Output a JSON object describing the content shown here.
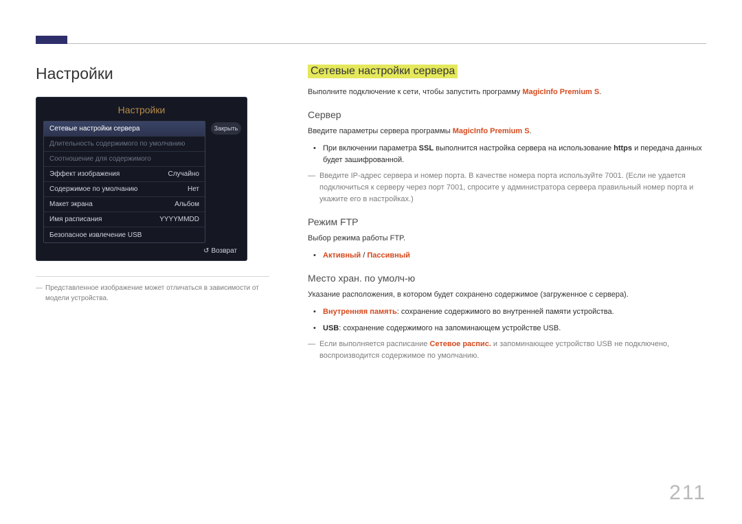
{
  "left": {
    "heading": "Настройки",
    "osd": {
      "title": "Настройки",
      "close": "Закрыть",
      "items": [
        {
          "label": "Сетевые настройки сервера",
          "value": ""
        },
        {
          "label": "Длительность содержимого по умолчанию",
          "value": ""
        },
        {
          "label": "Соотношение для содержимого",
          "value": ""
        },
        {
          "label": "Эффект изображения",
          "value": "Случайно"
        },
        {
          "label": "Содержимое по умолчанию",
          "value": "Нет"
        },
        {
          "label": "Макет экрана",
          "value": "Альбом"
        },
        {
          "label": "Имя расписания",
          "value": "YYYYMMDD"
        },
        {
          "label": "Безопасное извлечение USB",
          "value": ""
        }
      ],
      "return": "Возврат"
    },
    "note": "Представленное изображение может отличаться в зависимости от модели устройства."
  },
  "right": {
    "h2": "Сетевые настройки сервера",
    "intro_a": "Выполните подключение к сети, чтобы запустить программу ",
    "intro_product": "MagicInfo Premium S",
    "intro_b": ".",
    "server_h": "Сервер",
    "server_p1_a": "Введите параметры сервера программы ",
    "server_p1_prod": "MagicInfo Premium S",
    "server_p1_b": ".",
    "server_li_a": "При включении параметра ",
    "server_li_ssl": "SSL",
    "server_li_b": " выполнится настройка сервера на использование ",
    "server_li_https": "https",
    "server_li_c": " и передача данных будет зашифрованной.",
    "server_note": "Введите IP-адрес сервера и номер порта. В качестве номера порта используйте 7001. (Если не удается подключиться к серверу через порт 7001, спросите у администратора сервера правильный номер порта и укажите его в настройках.)",
    "ftp_h": "Режим FTP",
    "ftp_p": "Выбор режима работы FTP.",
    "ftp_active": "Активный",
    "ftp_sep": " / ",
    "ftp_passive": "Пассивный",
    "store_h": "Место хран. по умолч-ю",
    "store_p": "Указание расположения, в котором будет сохранено содержимое (загруженное с сервера).",
    "store_li1_a": "Внутренняя память",
    "store_li1_b": ": сохранение содержимого во внутренней памяти устройства.",
    "store_li2_a": "USB",
    "store_li2_b": ": сохранение содержимого на запоминающем устройстве USB.",
    "store_note_a": "Если выполняется расписание ",
    "store_note_em": "Сетевое распис.",
    "store_note_b": " и запоминающее устройство USB не подключено, воспроизводится содержимое по умолчанию."
  },
  "page": "211"
}
